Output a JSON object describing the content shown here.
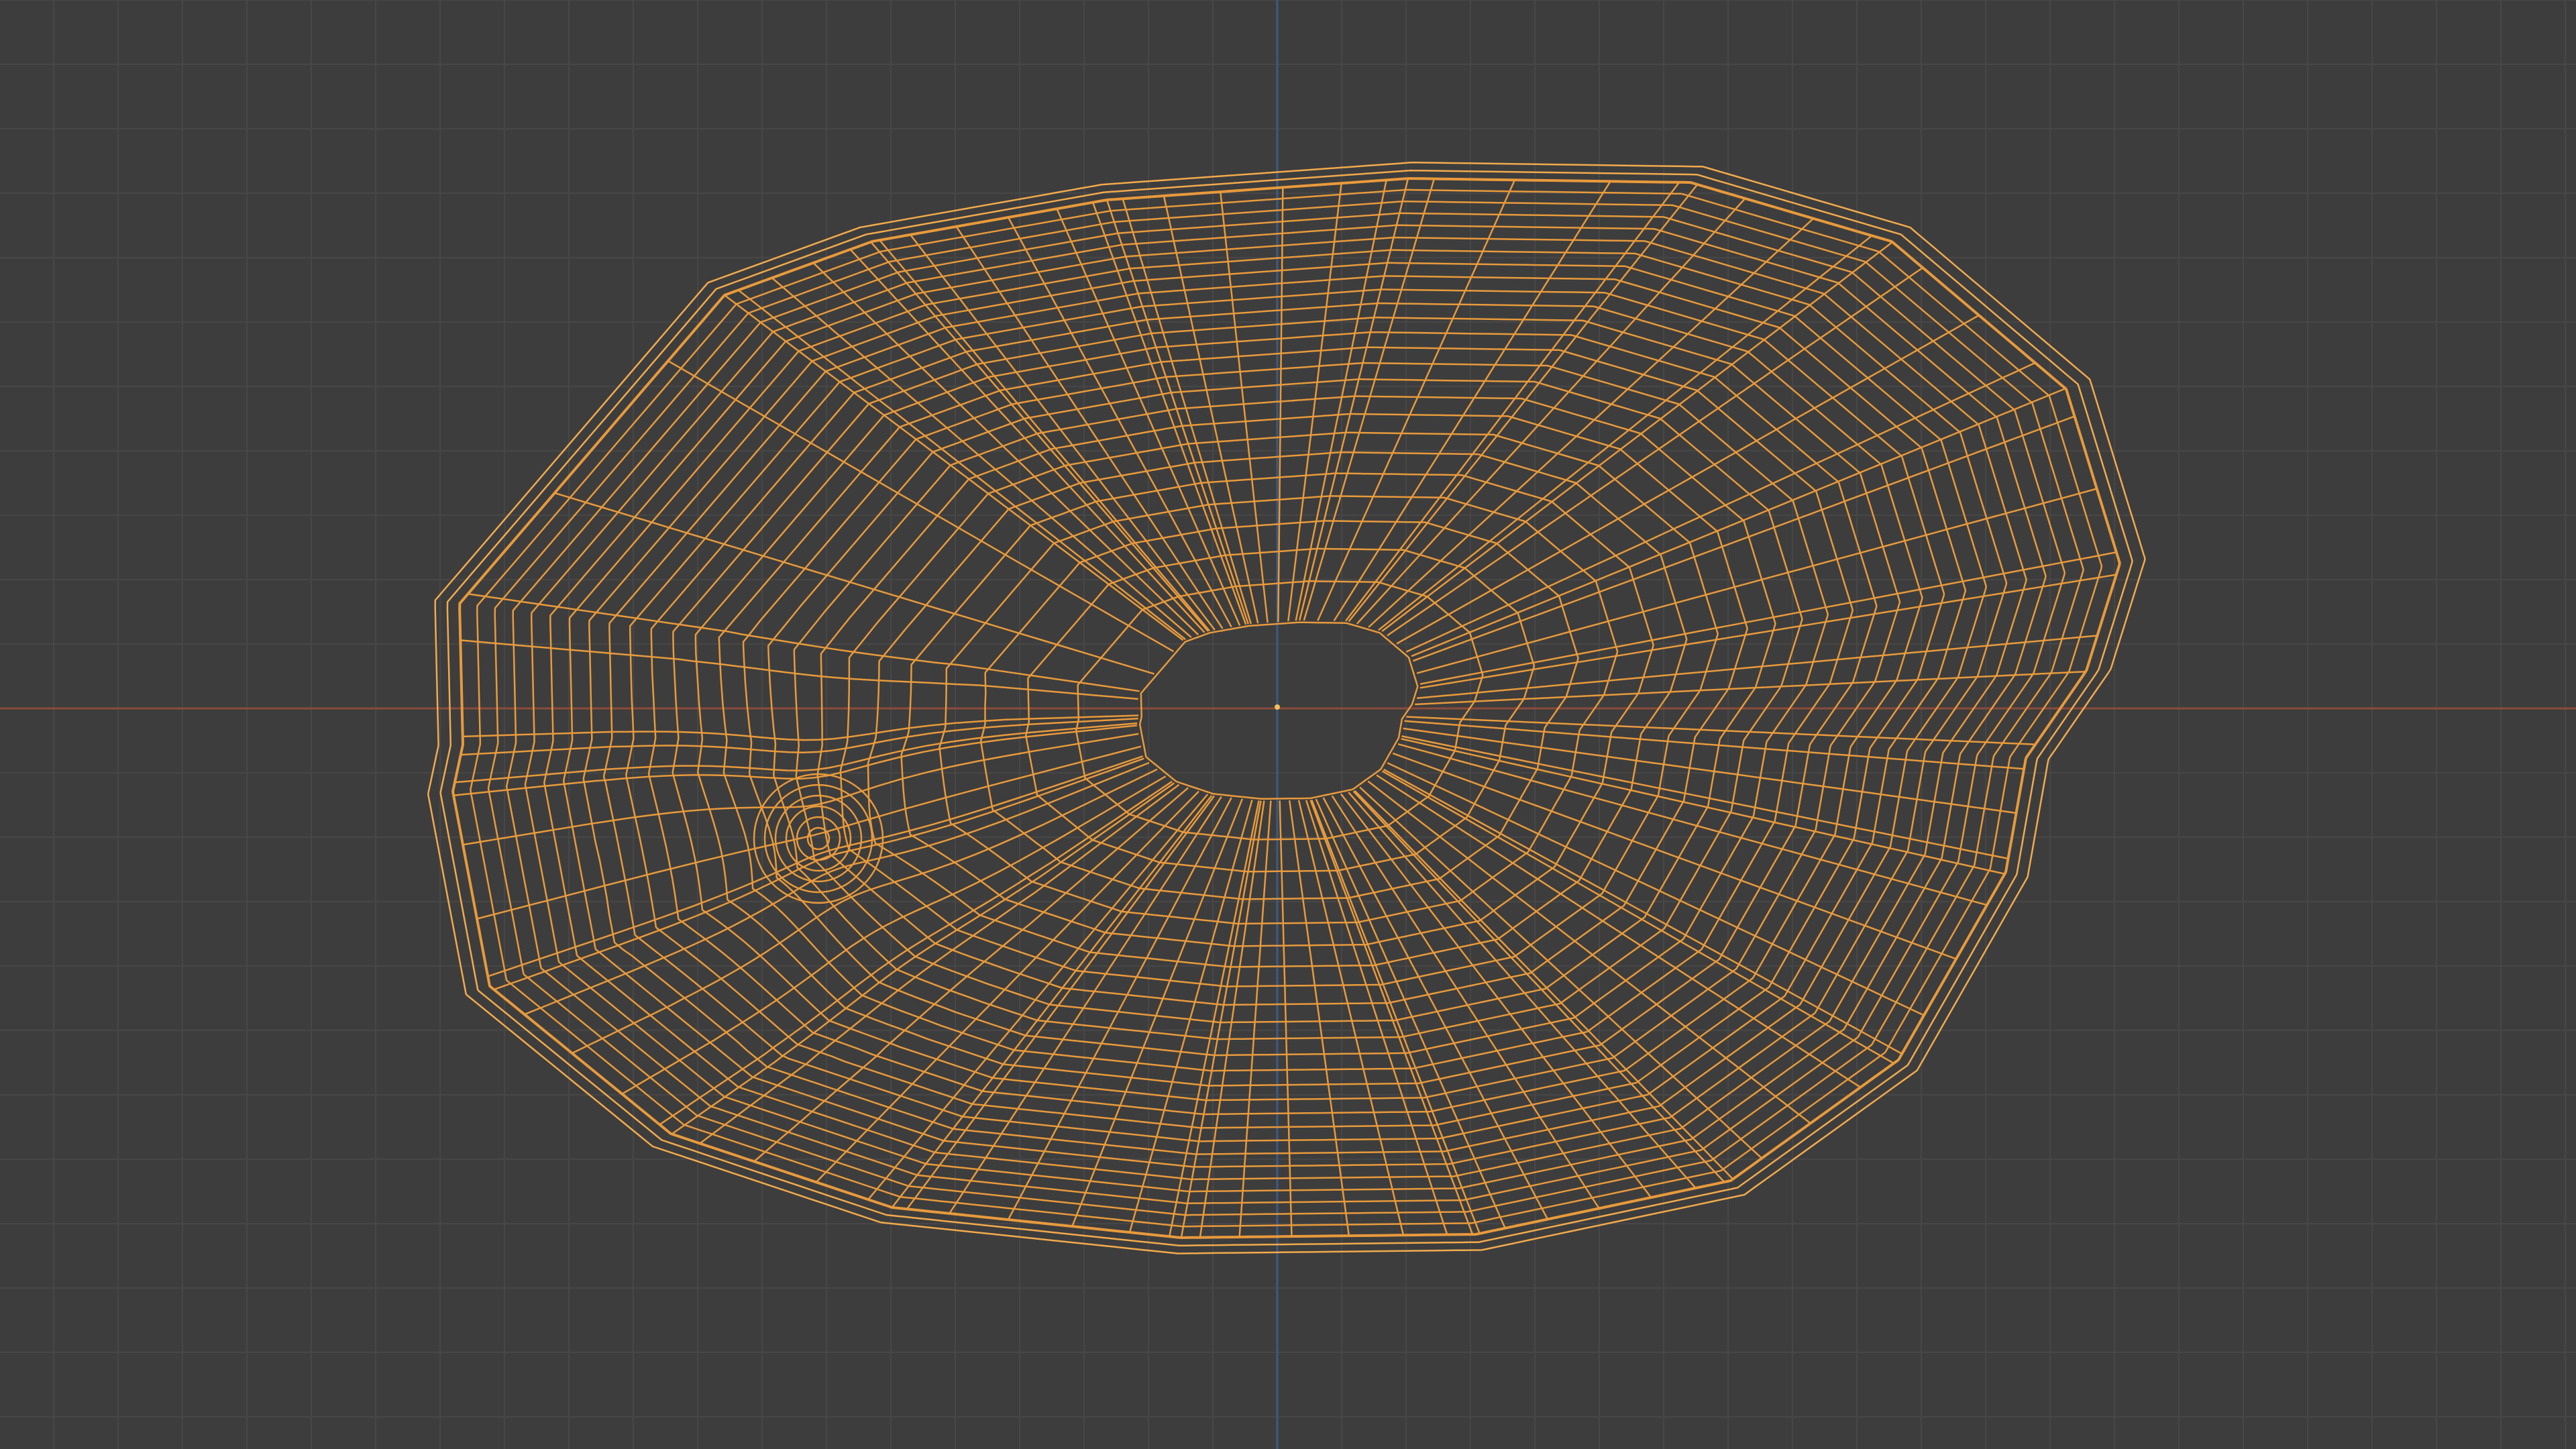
{
  "viewport": {
    "mode": "wireframe",
    "object": "mesh",
    "background_color": "#3d3d3d",
    "grid_color": "#474747",
    "x_axis_color": "#8a4b3c",
    "y_axis_color": "#3d5a80",
    "wire_color": "#e89a3c",
    "wire_highlight_color": "#f2aa4c",
    "origin_color": "#f0c060",
    "grid_visible": true
  }
}
